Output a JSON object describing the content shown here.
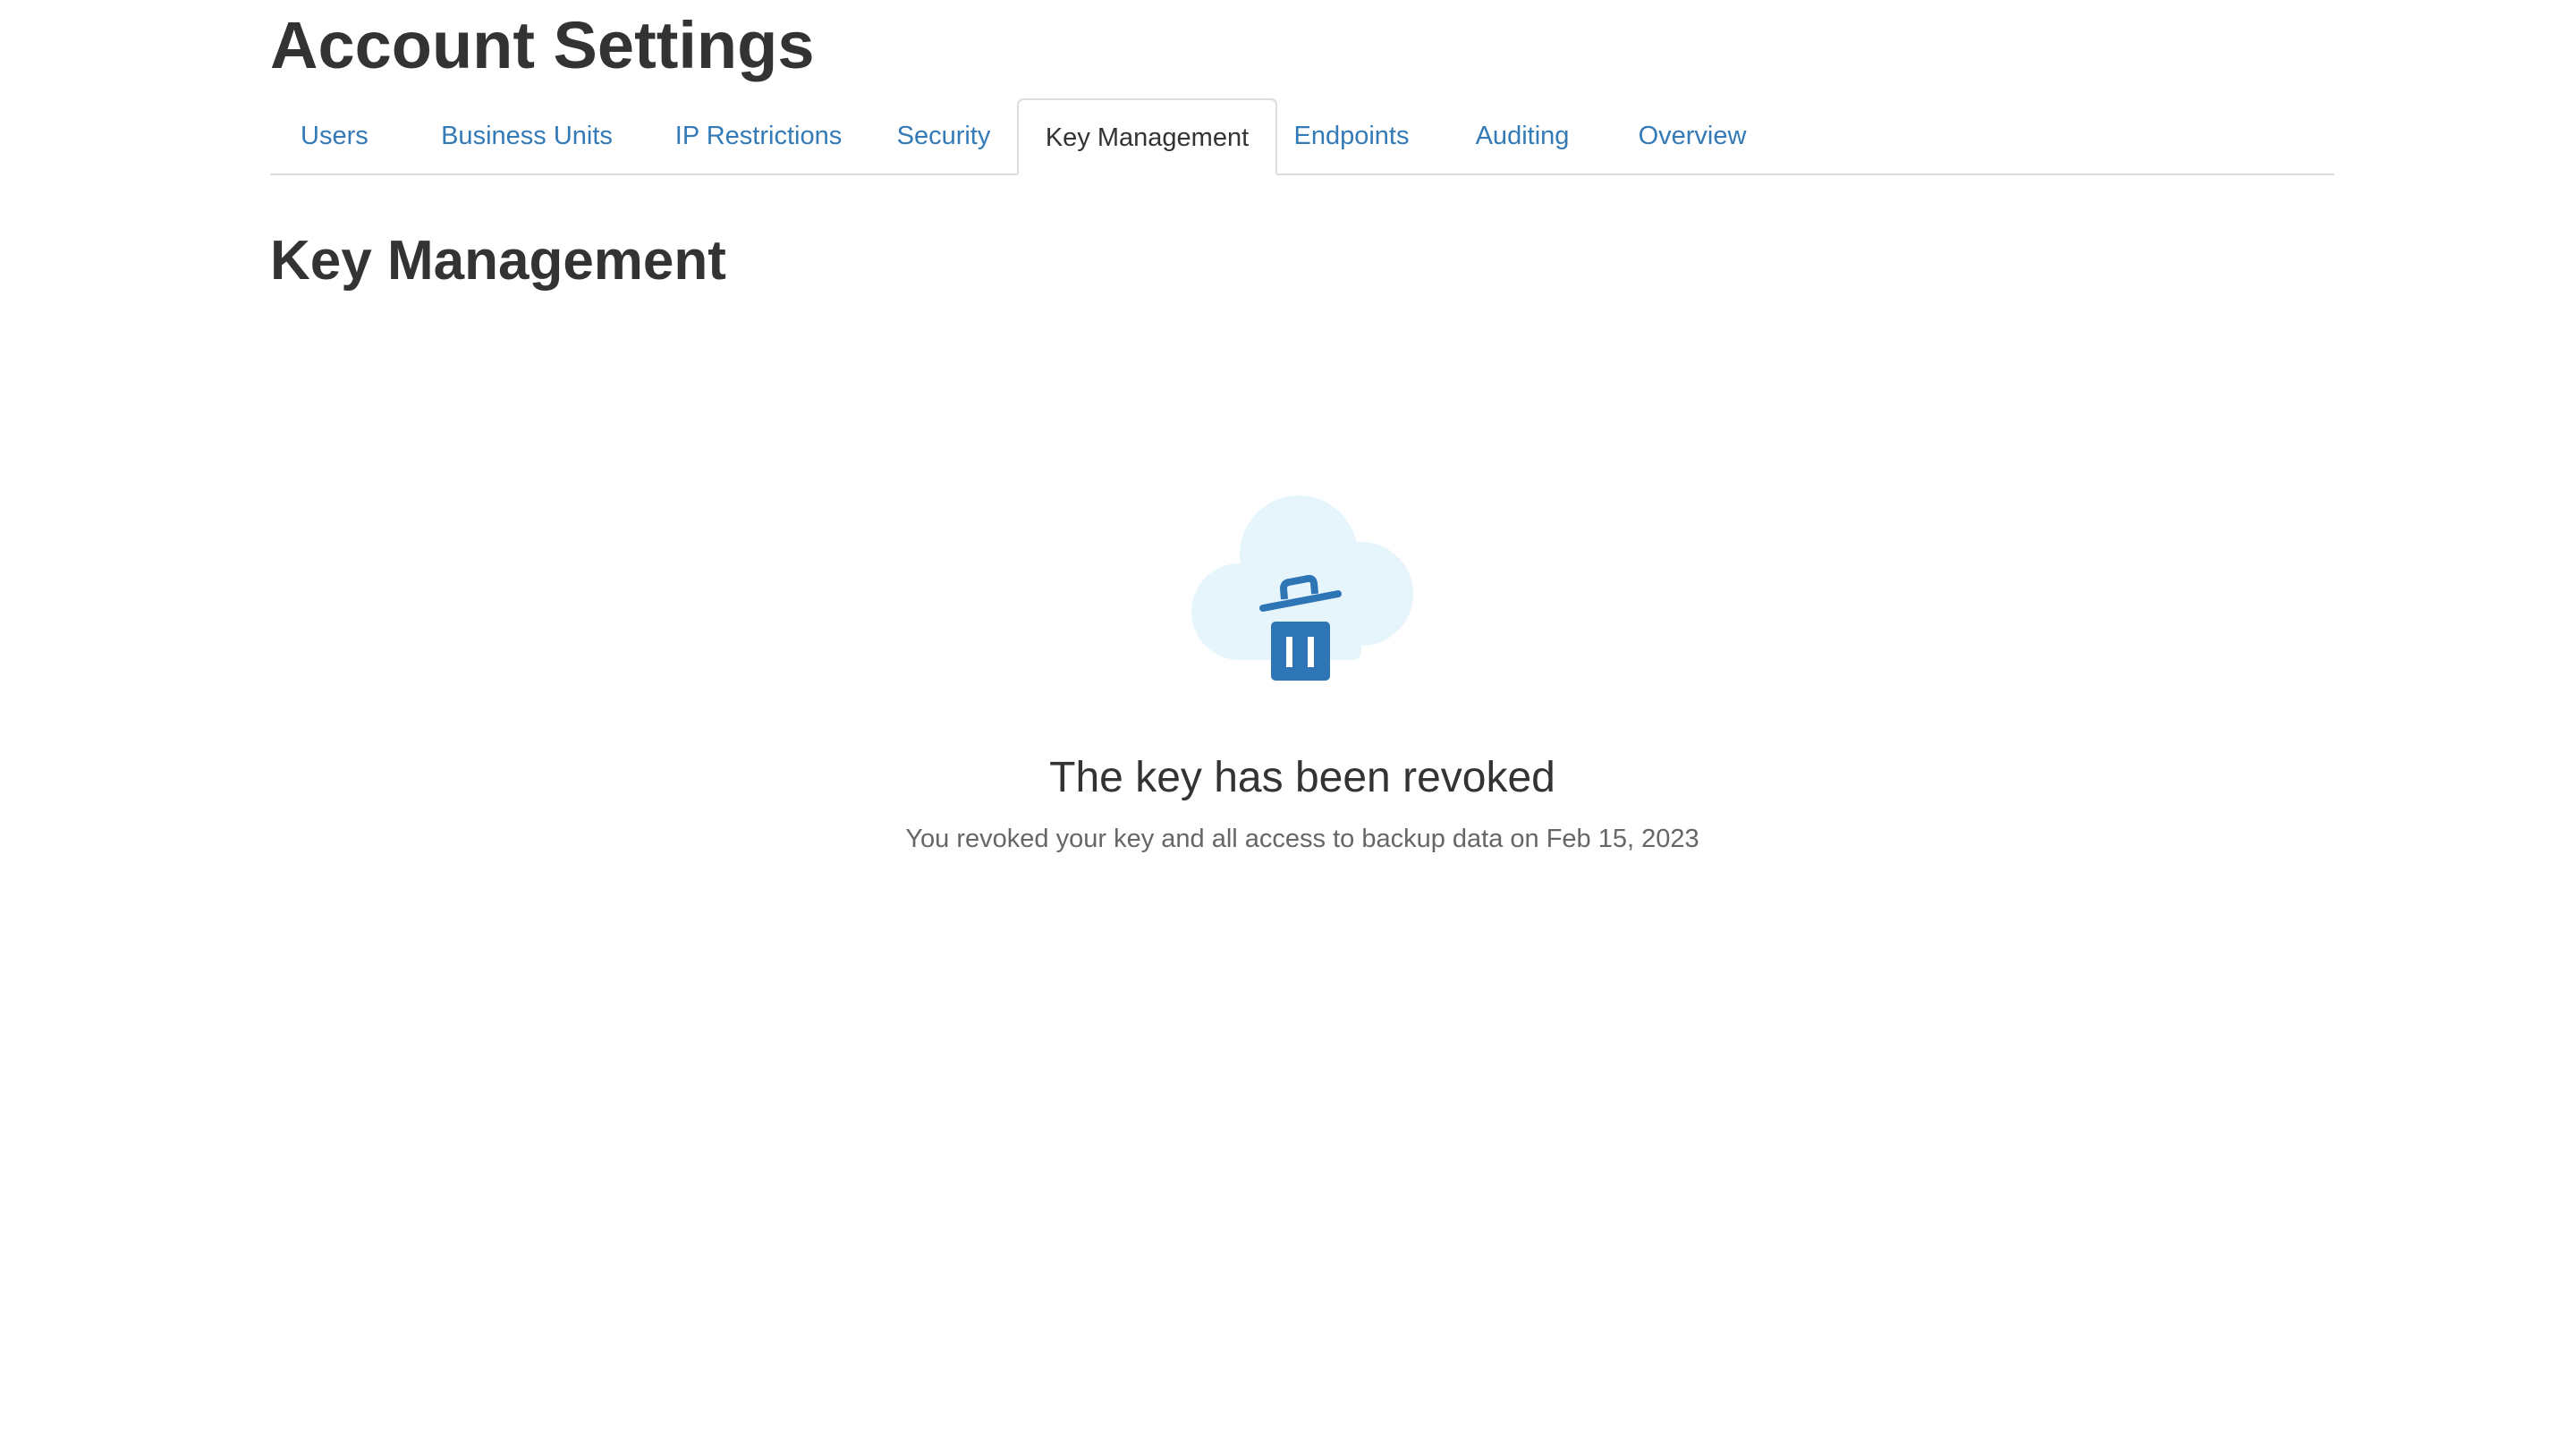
{
  "page": {
    "title": "Account Settings"
  },
  "tabs": [
    {
      "label": "Users",
      "active": false
    },
    {
      "label": "Business Units",
      "active": false
    },
    {
      "label": "IP Restrictions",
      "active": false
    },
    {
      "label": "Security",
      "active": false
    },
    {
      "label": "Key Management",
      "active": true
    },
    {
      "label": "Endpoints",
      "active": false
    },
    {
      "label": "Auditing",
      "active": false
    },
    {
      "label": "Overview",
      "active": false
    }
  ],
  "section": {
    "title": "Key Management"
  },
  "empty_state": {
    "icon": "cloud-trash-icon",
    "title": "The key has been revoked",
    "description": "You revoked your key and all access to backup data on Feb 15, 2023"
  },
  "colors": {
    "link": "#337ab7",
    "text": "#333333",
    "muted": "#666666",
    "border": "#dddddd",
    "cloud": "#e6f4fc",
    "icon": "#2e75b6"
  }
}
